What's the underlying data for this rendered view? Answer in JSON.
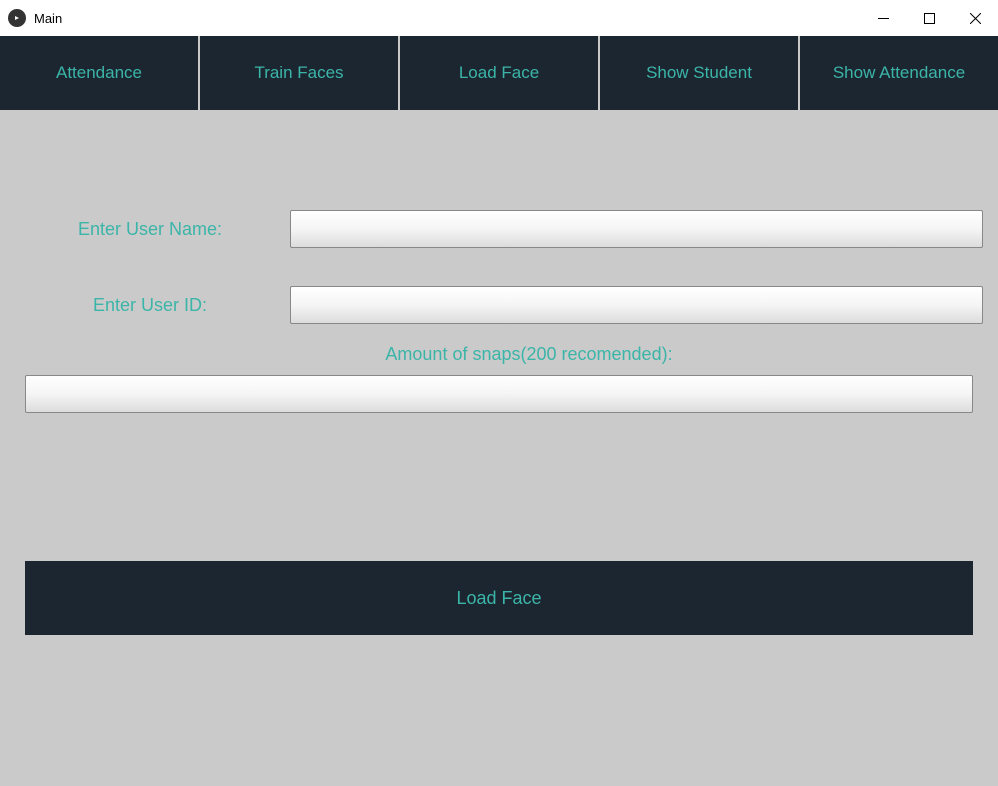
{
  "window": {
    "title": "Main"
  },
  "nav": {
    "tabs": [
      "Attendance",
      "Train Faces",
      "Load Face",
      "Show Student",
      "Show Attendance"
    ]
  },
  "form": {
    "username_label": "Enter User Name:",
    "username_value": "",
    "userid_label": "Enter User ID:",
    "userid_value": "",
    "snaps_label": "Amount of snaps(200 recomended):",
    "snaps_value": ""
  },
  "actions": {
    "load_face_label": "Load Face"
  }
}
